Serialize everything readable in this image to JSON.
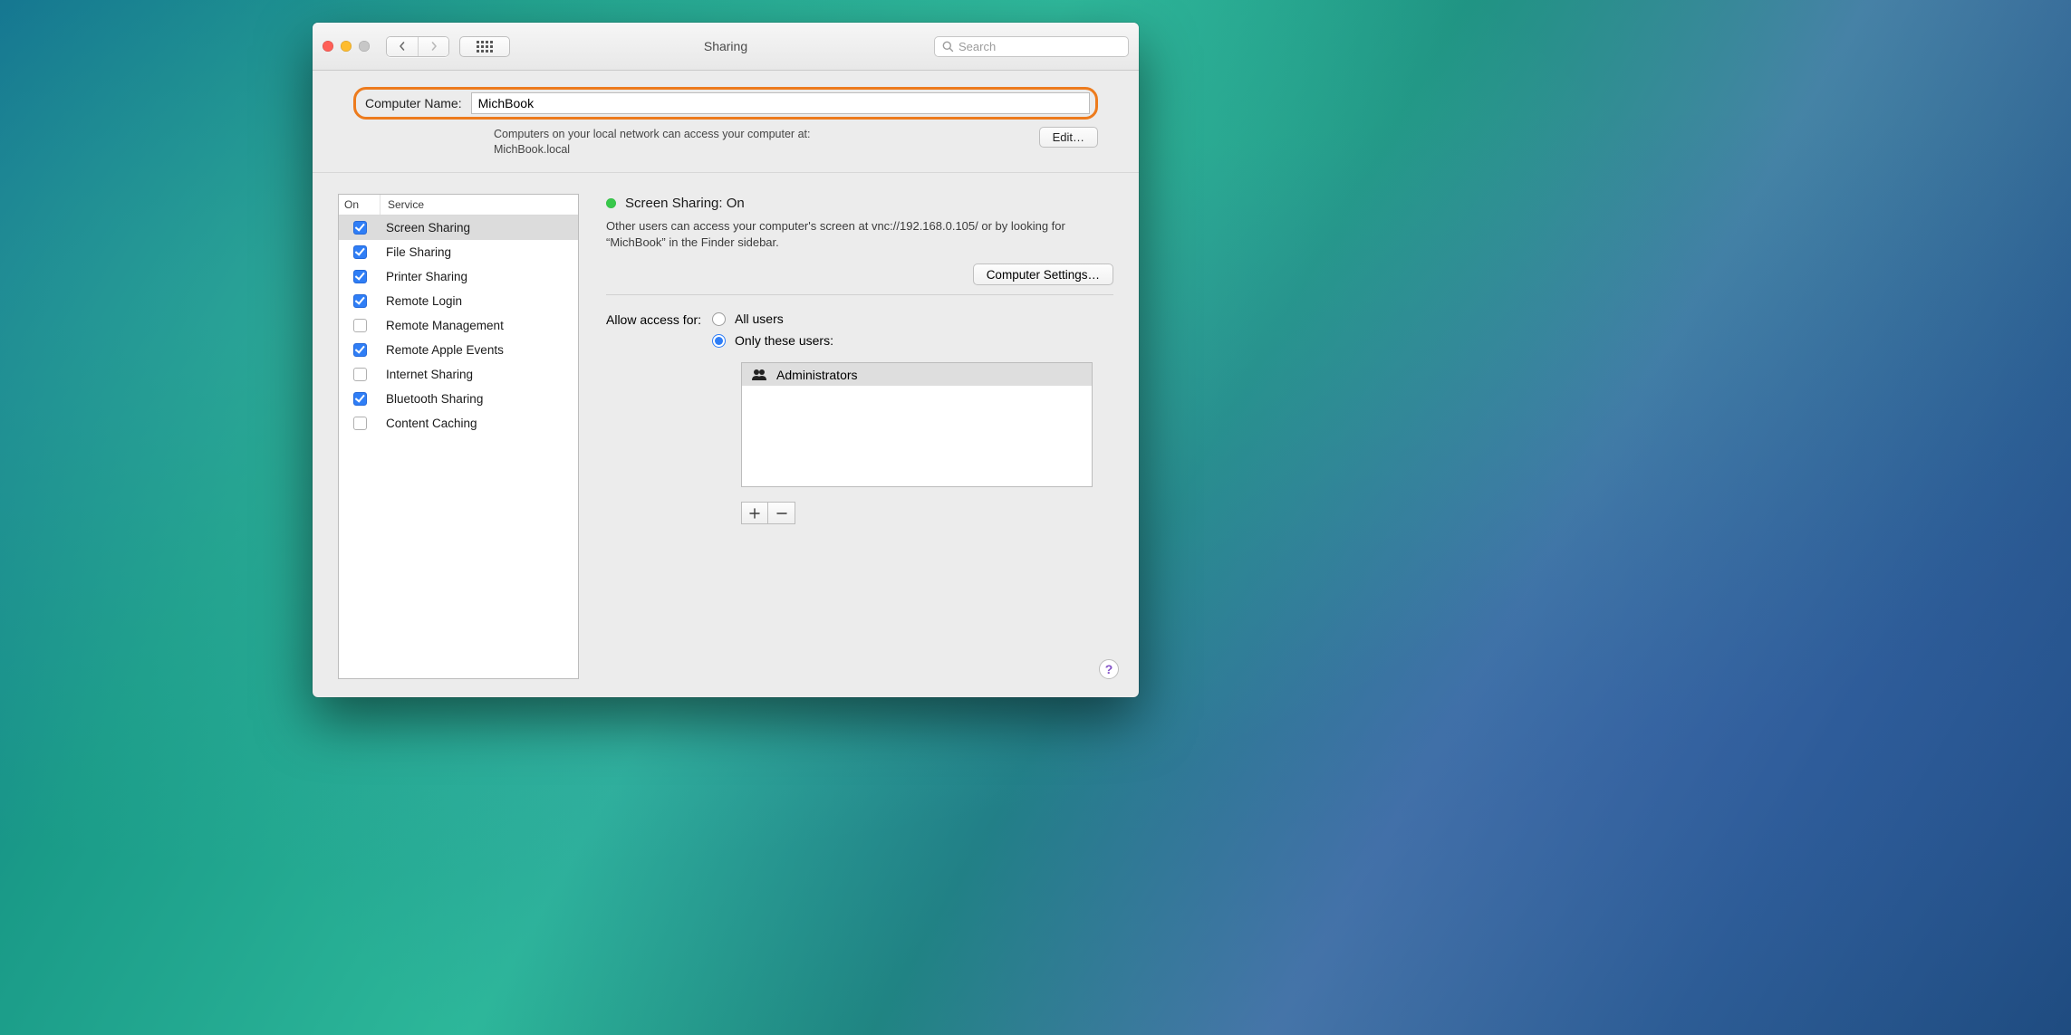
{
  "window": {
    "title": "Sharing"
  },
  "search": {
    "placeholder": "Search"
  },
  "computer_name": {
    "label": "Computer Name:",
    "value": "MichBook",
    "subtext_line1": "Computers on your local network can access your computer at:",
    "subtext_line2": "MichBook.local",
    "edit_label": "Edit…"
  },
  "services": {
    "col_on": "On",
    "col_service": "Service",
    "rows": [
      {
        "label": "Screen Sharing",
        "on": true,
        "selected": true
      },
      {
        "label": "File Sharing",
        "on": true,
        "selected": false
      },
      {
        "label": "Printer Sharing",
        "on": true,
        "selected": false
      },
      {
        "label": "Remote Login",
        "on": true,
        "selected": false
      },
      {
        "label": "Remote Management",
        "on": false,
        "selected": false
      },
      {
        "label": "Remote Apple Events",
        "on": true,
        "selected": false
      },
      {
        "label": "Internet Sharing",
        "on": false,
        "selected": false
      },
      {
        "label": "Bluetooth Sharing",
        "on": true,
        "selected": false
      },
      {
        "label": "Content Caching",
        "on": false,
        "selected": false
      }
    ]
  },
  "detail": {
    "status_title": "Screen Sharing: On",
    "status_desc": "Other users can access your computer's screen at vnc://192.168.0.105/ or by looking for “MichBook” in the Finder sidebar.",
    "computer_settings_label": "Computer Settings…",
    "access_label": "Allow access for:",
    "radio_all": "All users",
    "radio_only": "Only these users:",
    "selected_radio": "only",
    "users": [
      {
        "name": "Administrators"
      }
    ],
    "add_label": "+",
    "remove_label": "–"
  },
  "help": {
    "label": "?"
  }
}
